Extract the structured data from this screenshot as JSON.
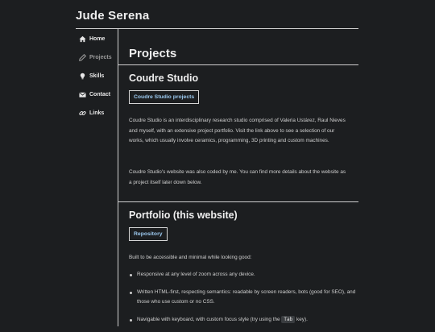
{
  "site": {
    "title": "Jude Serena"
  },
  "sidebar": {
    "items": [
      {
        "label": "Home",
        "icon": "home-icon"
      },
      {
        "label": "Projects",
        "icon": "pencil-icon",
        "active": true
      },
      {
        "label": "Skills",
        "icon": "lightbulb-icon"
      },
      {
        "label": "Contact",
        "icon": "envelope-icon"
      },
      {
        "label": "Links",
        "icon": "link-icon"
      }
    ]
  },
  "main": {
    "page_title": "Projects",
    "sections": [
      {
        "title": "Coudre Studio",
        "link_label": "Coudre Studio projects",
        "paragraphs": [
          "Coudre Studio is an interdisciplinary research studio comprised of Valeria Ustárez, Raul Nieves and myself, with an extensive project portfolio. Visit the link above to see a selection of our works, which usually involve ceramics, programming, 3D printing and custom machines.",
          "Coudre Studio's website was also coded by me. You can find more details about the website as a project itself later down below."
        ]
      },
      {
        "title": "Portfolio (this website)",
        "link_label": "Repository",
        "intro": "Built to be accessible and minimal while looking good:",
        "bullets": [
          "Responsive at any level of zoom across any device.",
          "Written HTML-first, respecting semantics: readable by screen readers, bots (good for SEO), and those who use custom or no CSS."
        ],
        "bullet3": {
          "before": "Navigable with keyboard, with custom focus style (try using the",
          "key": "Tab",
          "after": "key)."
        }
      }
    ]
  },
  "colors": {
    "background": "#1c1e20",
    "text": "#cfcfcf",
    "heading": "#eeeeee",
    "link": "#9ccaf0",
    "rule": "#d0d0d0"
  }
}
